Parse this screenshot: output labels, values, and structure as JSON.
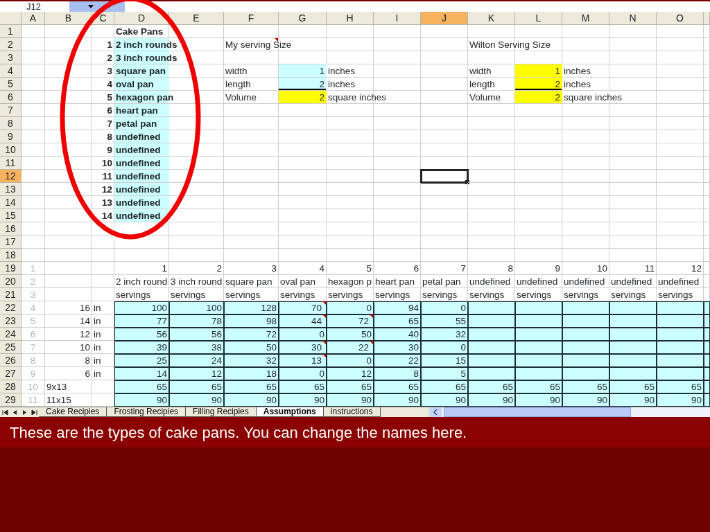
{
  "name_box": "J12",
  "columns": [
    {
      "label": "A",
      "selected": false
    },
    {
      "label": "B",
      "selected": false
    },
    {
      "label": "C",
      "selected": false
    },
    {
      "label": "D",
      "selected": false
    },
    {
      "label": "E",
      "selected": false
    },
    {
      "label": "F",
      "selected": false
    },
    {
      "label": "G",
      "selected": false
    },
    {
      "label": "H",
      "selected": false
    },
    {
      "label": "I",
      "selected": false
    },
    {
      "label": "J",
      "selected": true
    },
    {
      "label": "K",
      "selected": false
    },
    {
      "label": "L",
      "selected": false
    },
    {
      "label": "M",
      "selected": false
    },
    {
      "label": "N",
      "selected": false
    },
    {
      "label": "O",
      "selected": false
    },
    {
      "selected": false
    }
  ],
  "rows": [
    {
      "number": "1",
      "selected": false,
      "cells": [
        null,
        null,
        null,
        {
          "text": "Cake Pans",
          "bold": true
        },
        null,
        null,
        null,
        null,
        null,
        null,
        null,
        null,
        null,
        null,
        null,
        null
      ]
    },
    {
      "number": "2",
      "selected": false,
      "cells": [
        null,
        null,
        {
          "text": "1",
          "bold": true,
          "right_aligned": true
        },
        {
          "text": "2 inch rounds",
          "bold": true,
          "color": "#ccffff"
        },
        null,
        {
          "text": "My serving Size",
          "comment": true
        },
        null,
        null,
        null,
        null,
        {
          "text": "Wilton Serving Size"
        },
        null,
        null,
        null,
        null,
        null
      ]
    },
    {
      "number": "3",
      "selected": false,
      "cells": [
        null,
        null,
        {
          "text": "2",
          "bold": true,
          "right_aligned": true
        },
        {
          "text": "3 inch rounds",
          "bold": true,
          "color": "#ccffff"
        },
        null,
        null,
        null,
        null,
        null,
        null,
        null,
        null,
        null,
        null,
        null,
        null
      ]
    },
    {
      "number": "4",
      "selected": false,
      "cells": [
        null,
        null,
        {
          "text": "3",
          "bold": true,
          "right_aligned": true
        },
        {
          "text": "square pan",
          "bold": true,
          "color": "#ccffff"
        },
        null,
        {
          "text": "width"
        },
        {
          "text": "1",
          "right_aligned": true,
          "color": "#ccffff"
        },
        {
          "text": "inches"
        },
        null,
        null,
        {
          "text": "width"
        },
        {
          "text": "1",
          "right_aligned": true,
          "color": "#ffff00"
        },
        {
          "text": "inches"
        },
        null,
        null,
        null
      ]
    },
    {
      "number": "5",
      "selected": false,
      "cells": [
        null,
        null,
        {
          "text": "4",
          "bold": true,
          "right_aligned": true
        },
        {
          "text": "oval pan",
          "bold": true,
          "color": "#ccffff"
        },
        null,
        {
          "text": "length"
        },
        {
          "text": "2",
          "right_aligned": true,
          "color": "#ccffff",
          "border_bottom": true
        },
        {
          "text": "inches"
        },
        null,
        null,
        {
          "text": "length"
        },
        {
          "text": "2",
          "right_aligned": true,
          "color": "#ffff00",
          "border_bottom": true
        },
        {
          "text": "inches"
        },
        null,
        null,
        null
      ]
    },
    {
      "number": "6",
      "selected": false,
      "cells": [
        null,
        null,
        {
          "text": "5",
          "bold": true,
          "right_aligned": true
        },
        {
          "text": "hexagon pan",
          "bold": true,
          "color": "#ccffff"
        },
        null,
        {
          "text": "Volume"
        },
        {
          "text": "2",
          "right_aligned": true,
          "color": "#ffff00"
        },
        {
          "text": "square inches"
        },
        null,
        null,
        {
          "text": "Volume"
        },
        {
          "text": "2",
          "right_aligned": true,
          "color": "#ffff00"
        },
        {
          "text": "square inches"
        },
        null,
        null,
        null
      ]
    },
    {
      "number": "7",
      "selected": false,
      "cells": [
        null,
        null,
        {
          "text": "6",
          "bold": true,
          "right_aligned": true
        },
        {
          "text": "heart pan",
          "bold": true,
          "color": "#ccffff"
        },
        null,
        null,
        null,
        null,
        null,
        null,
        null,
        null,
        null,
        null,
        null,
        null
      ]
    },
    {
      "number": "8",
      "selected": false,
      "cells": [
        null,
        null,
        {
          "text": "7",
          "bold": true,
          "right_aligned": true
        },
        {
          "text": "petal pan",
          "bold": true,
          "color": "#ccffff"
        },
        null,
        null,
        null,
        null,
        null,
        null,
        null,
        null,
        null,
        null,
        null,
        null
      ]
    },
    {
      "number": "9",
      "selected": false,
      "cells": [
        null,
        null,
        {
          "text": "8",
          "bold": true,
          "right_aligned": true
        },
        {
          "text": "undefined",
          "bold": true,
          "color": "#ccffff"
        },
        null,
        null,
        null,
        null,
        null,
        null,
        null,
        null,
        null,
        null,
        null,
        null
      ]
    },
    {
      "number": "10",
      "selected": false,
      "cells": [
        null,
        null,
        {
          "text": "9",
          "bold": true,
          "right_aligned": true
        },
        {
          "text": "undefined",
          "bold": true,
          "color": "#ccffff"
        },
        null,
        null,
        null,
        null,
        null,
        null,
        null,
        null,
        null,
        null,
        null,
        null
      ]
    },
    {
      "number": "11",
      "selected": false,
      "cells": [
        null,
        null,
        {
          "text": "10",
          "bold": true,
          "right_aligned": true
        },
        {
          "text": "undefined",
          "bold": true,
          "color": "#ccffff"
        },
        null,
        null,
        null,
        null,
        null,
        null,
        null,
        null,
        null,
        null,
        null,
        null
      ]
    },
    {
      "number": "12",
      "selected": true,
      "cells": [
        null,
        null,
        {
          "text": "11",
          "bold": true,
          "right_aligned": true
        },
        {
          "text": "undefined",
          "bold": true,
          "color": "#ccffff"
        },
        null,
        null,
        null,
        null,
        null,
        {
          "active": true
        },
        null,
        null,
        null,
        null,
        null,
        null
      ]
    },
    {
      "number": "13",
      "selected": false,
      "cells": [
        null,
        null,
        {
          "text": "12",
          "bold": true,
          "right_aligned": true
        },
        {
          "text": "undefined",
          "bold": true,
          "color": "#ccffff"
        },
        null,
        null,
        null,
        null,
        null,
        null,
        null,
        null,
        null,
        null,
        null,
        null
      ]
    },
    {
      "number": "14",
      "selected": false,
      "cells": [
        null,
        null,
        {
          "text": "13",
          "bold": true,
          "right_aligned": true
        },
        {
          "text": "undefined",
          "bold": true,
          "color": "#ccffff"
        },
        null,
        null,
        null,
        null,
        null,
        null,
        null,
        null,
        null,
        null,
        null,
        null
      ]
    },
    {
      "number": "15",
      "selected": false,
      "cells": [
        null,
        null,
        {
          "text": "14",
          "bold": true,
          "right_aligned": true
        },
        {
          "text": "undefined",
          "bold": true,
          "color": "#ccffff"
        },
        null,
        null,
        null,
        null,
        null,
        null,
        null,
        null,
        null,
        null,
        null,
        null
      ]
    },
    {
      "number": "16",
      "selected": false,
      "cells": [
        null,
        null,
        null,
        null,
        null,
        null,
        null,
        null,
        null,
        null,
        null,
        null,
        null,
        null,
        null,
        null
      ]
    },
    {
      "number": "17",
      "selected": false,
      "cells": [
        null,
        null,
        null,
        null,
        null,
        null,
        null,
        null,
        null,
        null,
        null,
        null,
        null,
        null,
        null,
        null
      ]
    },
    {
      "number": "18",
      "selected": false,
      "cells": [
        null,
        null,
        null,
        null,
        null,
        null,
        null,
        null,
        null,
        null,
        null,
        null,
        null,
        null,
        null,
        null
      ]
    },
    {
      "number": "19",
      "selected": false,
      "cells": [
        {
          "text": "1",
          "faint": true
        },
        null,
        null,
        {
          "text": "1",
          "right_aligned": true
        },
        {
          "text": "2",
          "right_aligned": true
        },
        {
          "text": "3",
          "right_aligned": true
        },
        {
          "text": "4",
          "right_aligned": true
        },
        {
          "text": "5",
          "right_aligned": true
        },
        {
          "text": "6",
          "right_aligned": true
        },
        {
          "text": "7",
          "right_aligned": true
        },
        {
          "text": "8",
          "right_aligned": true
        },
        {
          "text": "9",
          "right_aligned": true
        },
        {
          "text": "10",
          "right_aligned": true
        },
        {
          "text": "11",
          "right_aligned": true
        },
        {
          "text": "12",
          "right_aligned": true
        },
        null
      ]
    },
    {
      "number": "20",
      "selected": false,
      "cells": [
        {
          "text": "2",
          "faint": true
        },
        null,
        null,
        {
          "text": "2 inch round"
        },
        {
          "text": "3 inch round"
        },
        {
          "text": "square pan"
        },
        {
          "text": "oval pan"
        },
        {
          "text": "hexagon p"
        },
        {
          "text": "heart pan"
        },
        {
          "text": "petal pan"
        },
        {
          "text": "undefined"
        },
        {
          "text": "undefined"
        },
        {
          "text": "undefined"
        },
        {
          "text": "undefined"
        },
        {
          "text": "undefined"
        },
        null
      ]
    },
    {
      "number": "21",
      "selected": false,
      "cells": [
        {
          "text": "3",
          "faint": true
        },
        null,
        null,
        {
          "text": "servings"
        },
        {
          "text": "servings"
        },
        {
          "text": "servings"
        },
        {
          "text": "servings"
        },
        {
          "text": "servings"
        },
        {
          "text": "servings"
        },
        {
          "text": "servings"
        },
        {
          "text": "servings"
        },
        {
          "text": "servings"
        },
        {
          "text": "servings"
        },
        {
          "text": "servings"
        },
        {
          "text": "servings"
        },
        null
      ]
    },
    {
      "number": "22",
      "selected": false,
      "cells": [
        {
          "text": "4",
          "faint": true
        },
        {
          "text": "16",
          "right_aligned": true
        },
        {
          "text": "in"
        },
        {
          "text": "100",
          "right_aligned": true,
          "color": "#ccffff",
          "boxed": true
        },
        {
          "text": "100",
          "right_aligned": true,
          "color": "#ccffff",
          "boxed": true
        },
        {
          "text": "128",
          "right_aligned": true,
          "color": "#ccffff",
          "boxed": true
        },
        {
          "text": "70",
          "right_aligned": true,
          "color": "#ccffff",
          "boxed": true,
          "comment": true
        },
        {
          "text": "0",
          "right_aligned": true,
          "color": "#ccffff",
          "boxed": true
        },
        {
          "text": "94",
          "right_aligned": true,
          "color": "#ccffff",
          "boxed": true
        },
        {
          "text": "0",
          "right_aligned": true,
          "color": "#ccffff",
          "boxed": true
        },
        {
          "color": "#ccffff",
          "boxed": true
        },
        {
          "color": "#ccffff",
          "boxed": true
        },
        {
          "color": "#ccffff",
          "boxed": true
        },
        {
          "color": "#ccffff",
          "boxed": true
        },
        {
          "color": "#ccffff",
          "boxed": true
        },
        {
          "color": "#ccffff",
          "boxed": true
        }
      ]
    },
    {
      "number": "23",
      "selected": false,
      "cells": [
        {
          "text": "5",
          "faint": true
        },
        {
          "text": "14",
          "right_aligned": true
        },
        {
          "text": "in"
        },
        {
          "text": "77",
          "right_aligned": true,
          "color": "#ccffff",
          "boxed": true
        },
        {
          "text": "78",
          "right_aligned": true,
          "color": "#ccffff",
          "boxed": true
        },
        {
          "text": "98",
          "right_aligned": true,
          "color": "#ccffff",
          "boxed": true
        },
        {
          "text": "44",
          "right_aligned": true,
          "color": "#ccffff",
          "boxed": true,
          "comment": true
        },
        {
          "text": "72",
          "right_aligned": true,
          "color": "#ccffff",
          "boxed": true,
          "comment": true
        },
        {
          "text": "65",
          "right_aligned": true,
          "color": "#ccffff",
          "boxed": true
        },
        {
          "text": "55",
          "right_aligned": true,
          "color": "#ccffff",
          "boxed": true
        },
        {
          "color": "#ccffff",
          "boxed": true
        },
        {
          "color": "#ccffff",
          "boxed": true
        },
        {
          "color": "#ccffff",
          "boxed": true
        },
        {
          "color": "#ccffff",
          "boxed": true
        },
        {
          "color": "#ccffff",
          "boxed": true
        },
        {
          "color": "#ccffff",
          "boxed": true
        }
      ]
    },
    {
      "number": "24",
      "selected": false,
      "cells": [
        {
          "text": "6",
          "faint": true
        },
        {
          "text": "12",
          "right_aligned": true
        },
        {
          "text": "in"
        },
        {
          "text": "56",
          "right_aligned": true,
          "color": "#ccffff",
          "boxed": true
        },
        {
          "text": "56",
          "right_aligned": true,
          "color": "#ccffff",
          "boxed": true
        },
        {
          "text": "72",
          "right_aligned": true,
          "color": "#ccffff",
          "boxed": true
        },
        {
          "text": "0",
          "right_aligned": true,
          "color": "#ccffff",
          "boxed": true
        },
        {
          "text": "50",
          "right_aligned": true,
          "color": "#ccffff",
          "boxed": true
        },
        {
          "text": "40",
          "right_aligned": true,
          "color": "#ccffff",
          "boxed": true
        },
        {
          "text": "32",
          "right_aligned": true,
          "color": "#ccffff",
          "boxed": true
        },
        {
          "color": "#ccffff",
          "boxed": true
        },
        {
          "color": "#ccffff",
          "boxed": true
        },
        {
          "color": "#ccffff",
          "boxed": true
        },
        {
          "color": "#ccffff",
          "boxed": true
        },
        {
          "color": "#ccffff",
          "boxed": true
        },
        {
          "color": "#ccffff",
          "boxed": true
        }
      ]
    },
    {
      "number": "25",
      "selected": false,
      "cells": [
        {
          "text": "7",
          "faint": true
        },
        {
          "text": "10",
          "right_aligned": true
        },
        {
          "text": "in"
        },
        {
          "text": "39",
          "right_aligned": true,
          "color": "#ccffff",
          "boxed": true
        },
        {
          "text": "38",
          "right_aligned": true,
          "color": "#ccffff",
          "boxed": true
        },
        {
          "text": "50",
          "right_aligned": true,
          "color": "#ccffff",
          "boxed": true
        },
        {
          "text": "30",
          "right_aligned": true,
          "color": "#ccffff",
          "boxed": true,
          "comment": true
        },
        {
          "text": "22",
          "right_aligned": true,
          "color": "#ccffff",
          "boxed": true,
          "comment": true
        },
        {
          "text": "30",
          "right_aligned": true,
          "color": "#ccffff",
          "boxed": true
        },
        {
          "text": "0",
          "right_aligned": true,
          "color": "#ccffff",
          "boxed": true
        },
        {
          "color": "#ccffff",
          "boxed": true
        },
        {
          "color": "#ccffff",
          "boxed": true
        },
        {
          "color": "#ccffff",
          "boxed": true
        },
        {
          "color": "#ccffff",
          "boxed": true
        },
        {
          "color": "#ccffff",
          "boxed": true
        },
        {
          "color": "#ccffff",
          "boxed": true
        }
      ]
    },
    {
      "number": "26",
      "selected": false,
      "cells": [
        {
          "text": "8",
          "faint": true
        },
        {
          "text": "8",
          "right_aligned": true
        },
        {
          "text": "in"
        },
        {
          "text": "25",
          "right_aligned": true,
          "color": "#ccffff",
          "boxed": true
        },
        {
          "text": "24",
          "right_aligned": true,
          "color": "#ccffff",
          "boxed": true
        },
        {
          "text": "32",
          "right_aligned": true,
          "color": "#ccffff",
          "boxed": true
        },
        {
          "text": "13",
          "right_aligned": true,
          "color": "#ccffff",
          "boxed": true,
          "comment": true
        },
        {
          "text": "0",
          "right_aligned": true,
          "color": "#ccffff",
          "boxed": true
        },
        {
          "text": "22",
          "right_aligned": true,
          "color": "#ccffff",
          "boxed": true
        },
        {
          "text": "15",
          "right_aligned": true,
          "color": "#ccffff",
          "boxed": true
        },
        {
          "color": "#ccffff",
          "boxed": true
        },
        {
          "color": "#ccffff",
          "boxed": true
        },
        {
          "color": "#ccffff",
          "boxed": true
        },
        {
          "color": "#ccffff",
          "boxed": true
        },
        {
          "color": "#ccffff",
          "boxed": true
        },
        {
          "color": "#ccffff",
          "boxed": true
        }
      ]
    },
    {
      "number": "27",
      "selected": false,
      "cells": [
        {
          "text": "9",
          "faint": true
        },
        {
          "text": "6",
          "right_aligned": true
        },
        {
          "text": "in"
        },
        {
          "text": "14",
          "right_aligned": true,
          "color": "#ccffff",
          "boxed": true
        },
        {
          "text": "12",
          "right_aligned": true,
          "color": "#ccffff",
          "boxed": true
        },
        {
          "text": "18",
          "right_aligned": true,
          "color": "#ccffff",
          "boxed": true
        },
        {
          "text": "0",
          "right_aligned": true,
          "color": "#ccffff",
          "boxed": true
        },
        {
          "text": "12",
          "right_aligned": true,
          "color": "#ccffff",
          "boxed": true
        },
        {
          "text": "8",
          "right_aligned": true,
          "color": "#ccffff",
          "boxed": true
        },
        {
          "text": "5",
          "right_aligned": true,
          "color": "#ccffff",
          "boxed": true
        },
        {
          "color": "#ccffff",
          "boxed": true
        },
        {
          "color": "#ccffff",
          "boxed": true
        },
        {
          "color": "#ccffff",
          "boxed": true
        },
        {
          "color": "#ccffff",
          "boxed": true
        },
        {
          "color": "#ccffff",
          "boxed": true
        },
        {
          "color": "#ccffff",
          "boxed": true
        }
      ]
    },
    {
      "number": "28",
      "selected": false,
      "cells": [
        {
          "text": "10",
          "faint": true
        },
        {
          "text": "9x13"
        },
        null,
        {
          "text": "65",
          "right_aligned": true,
          "color": "#ccffff",
          "boxed": true
        },
        {
          "text": "65",
          "right_aligned": true,
          "color": "#ccffff",
          "boxed": true
        },
        {
          "text": "65",
          "right_aligned": true,
          "color": "#ccffff",
          "boxed": true
        },
        {
          "text": "65",
          "right_aligned": true,
          "color": "#ccffff",
          "boxed": true
        },
        {
          "text": "65",
          "right_aligned": true,
          "color": "#ccffff",
          "boxed": true
        },
        {
          "text": "65",
          "right_aligned": true,
          "color": "#ccffff",
          "boxed": true
        },
        {
          "text": "65",
          "right_aligned": true,
          "color": "#ccffff",
          "boxed": true
        },
        {
          "text": "65",
          "right_aligned": true,
          "color": "#ccffff",
          "boxed": true
        },
        {
          "text": "65",
          "right_aligned": true,
          "color": "#ccffff",
          "boxed": true
        },
        {
          "text": "65",
          "right_aligned": true,
          "color": "#ccffff",
          "boxed": true
        },
        {
          "text": "65",
          "right_aligned": true,
          "color": "#ccffff",
          "boxed": true
        },
        {
          "text": "65",
          "right_aligned": true,
          "color": "#ccffff",
          "boxed": true
        },
        {
          "color": "#ccffff",
          "boxed": true
        }
      ]
    },
    {
      "number": "29",
      "selected": false,
      "cells": [
        {
          "text": "11",
          "faint": true
        },
        {
          "text": "11x15"
        },
        null,
        {
          "text": "90",
          "right_aligned": true,
          "color": "#ccffff",
          "boxed": true
        },
        {
          "text": "90",
          "right_aligned": true,
          "color": "#ccffff",
          "boxed": true
        },
        {
          "text": "90",
          "right_aligned": true,
          "color": "#ccffff",
          "boxed": true
        },
        {
          "text": "90",
          "right_aligned": true,
          "color": "#ccffff",
          "boxed": true
        },
        {
          "text": "90",
          "right_aligned": true,
          "color": "#ccffff",
          "boxed": true
        },
        {
          "text": "90",
          "right_aligned": true,
          "color": "#ccffff",
          "boxed": true
        },
        {
          "text": "90",
          "right_aligned": true,
          "color": "#ccffff",
          "boxed": true
        },
        {
          "text": "90",
          "right_aligned": true,
          "color": "#ccffff",
          "boxed": true
        },
        {
          "text": "90",
          "right_aligned": true,
          "color": "#ccffff",
          "boxed": true
        },
        {
          "text": "90",
          "right_aligned": true,
          "color": "#ccffff",
          "boxed": true
        },
        {
          "text": "90",
          "right_aligned": true,
          "color": "#ccffff",
          "boxed": true
        },
        {
          "text": "90",
          "right_aligned": true,
          "color": "#ccffff",
          "boxed": true
        },
        {
          "color": "#ccffff",
          "boxed": true
        }
      ]
    }
  ],
  "sheet_tabs": [
    {
      "label": "Cake Recipies",
      "selected": false
    },
    {
      "label": "Frosting Recipies",
      "selected": false
    },
    {
      "label": "Filling Recipies",
      "selected": false
    },
    {
      "label": "Assumptions",
      "selected": true
    },
    {
      "label": "instructions",
      "selected": false
    }
  ],
  "annotation": {
    "kind": "ellipse"
  },
  "caption": "These are the types of cake pans. You can change the names here."
}
